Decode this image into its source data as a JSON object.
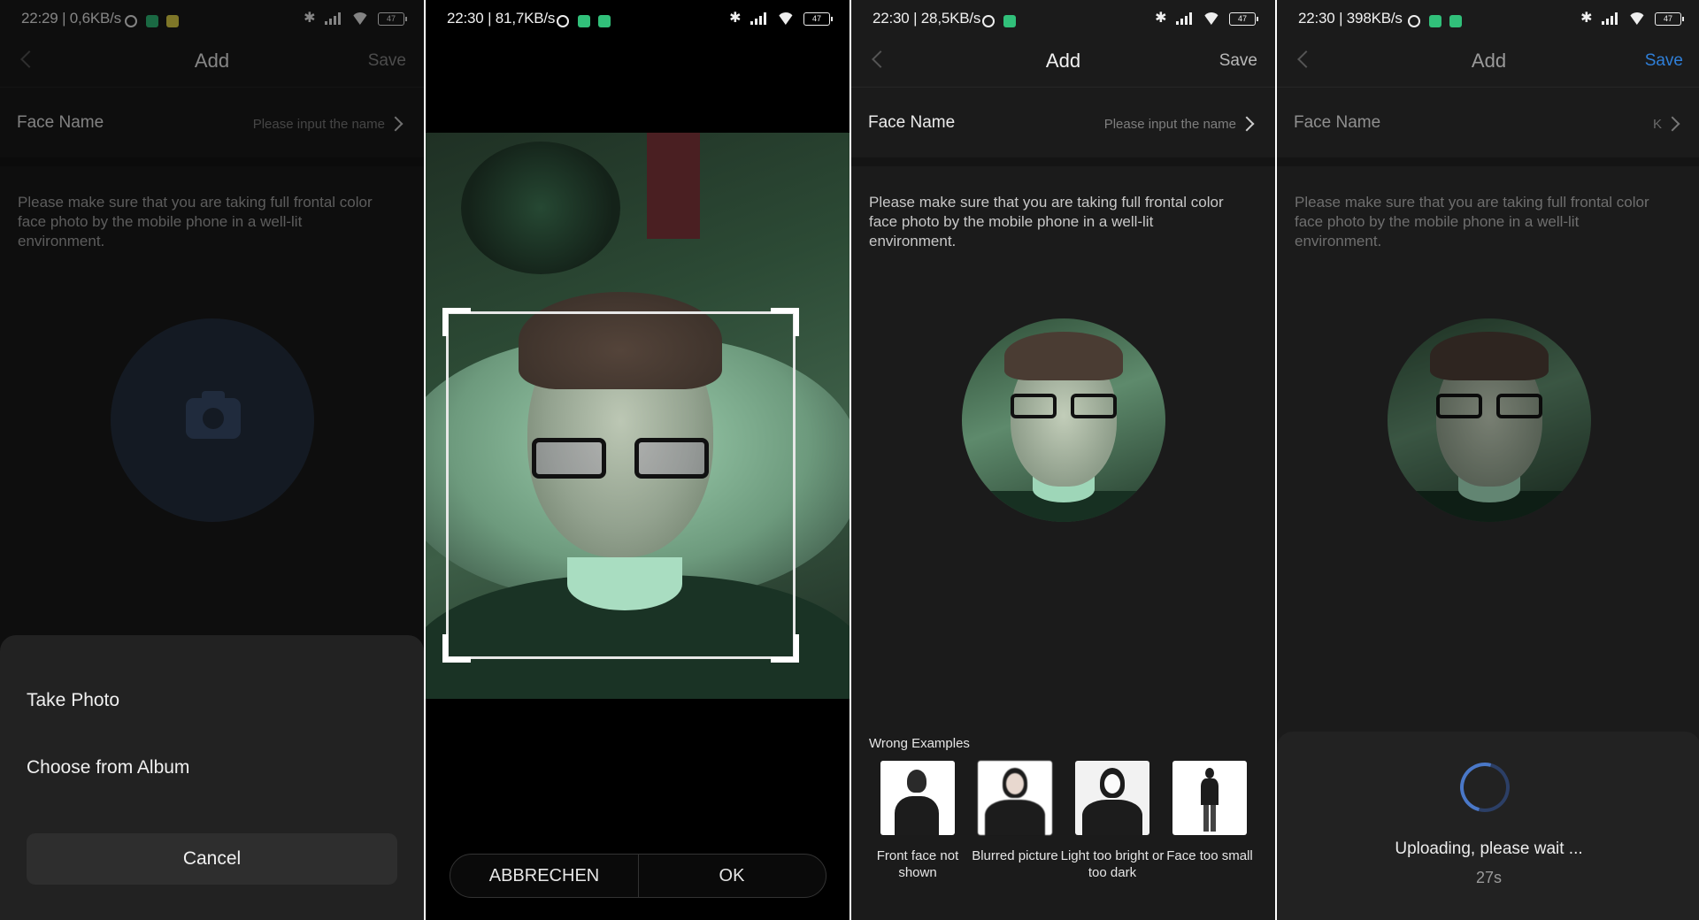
{
  "panel1": {
    "status": {
      "time": "22:29 | 0,6KB/s",
      "battery": "47"
    },
    "nav": {
      "title": "Add",
      "save": "Save"
    },
    "face_name": {
      "label": "Face Name",
      "placeholder": "Please input the name"
    },
    "hint": "Please make sure that you are taking full frontal color face photo by the mobile phone in a well-lit environment.",
    "sheet": {
      "take_photo": "Take Photo",
      "choose_album": "Choose from Album",
      "cancel": "Cancel"
    }
  },
  "panel2": {
    "status": {
      "time": "22:30 | 81,7KB/s",
      "battery": "47"
    },
    "buttons": {
      "cancel": "ABBRECHEN",
      "ok": "OK"
    }
  },
  "panel3": {
    "status": {
      "time": "22:30 | 28,5KB/s",
      "battery": "47"
    },
    "nav": {
      "title": "Add",
      "save": "Save"
    },
    "face_name": {
      "label": "Face Name",
      "placeholder": "Please input the name"
    },
    "hint": "Please make sure that you are taking full frontal color face photo by the mobile phone in a well-lit environment.",
    "wrong_examples": {
      "title": "Wrong Examples",
      "items": [
        {
          "caption": "Front face not shown"
        },
        {
          "caption": "Blurred picture"
        },
        {
          "caption": "Light too bright or too dark"
        },
        {
          "caption": "Face too small"
        }
      ]
    }
  },
  "panel4": {
    "status": {
      "time": "22:30 | 398KB/s",
      "battery": "47"
    },
    "nav": {
      "title": "Add",
      "save": "Save",
      "save_color": "#2f7fd8"
    },
    "face_name": {
      "label": "Face Name",
      "value": "K"
    },
    "hint": "Please make sure that you are taking full frontal color face photo by the mobile phone in a well-lit environment.",
    "upload": {
      "message": "Uploading, please wait ...",
      "seconds": "27s"
    }
  }
}
